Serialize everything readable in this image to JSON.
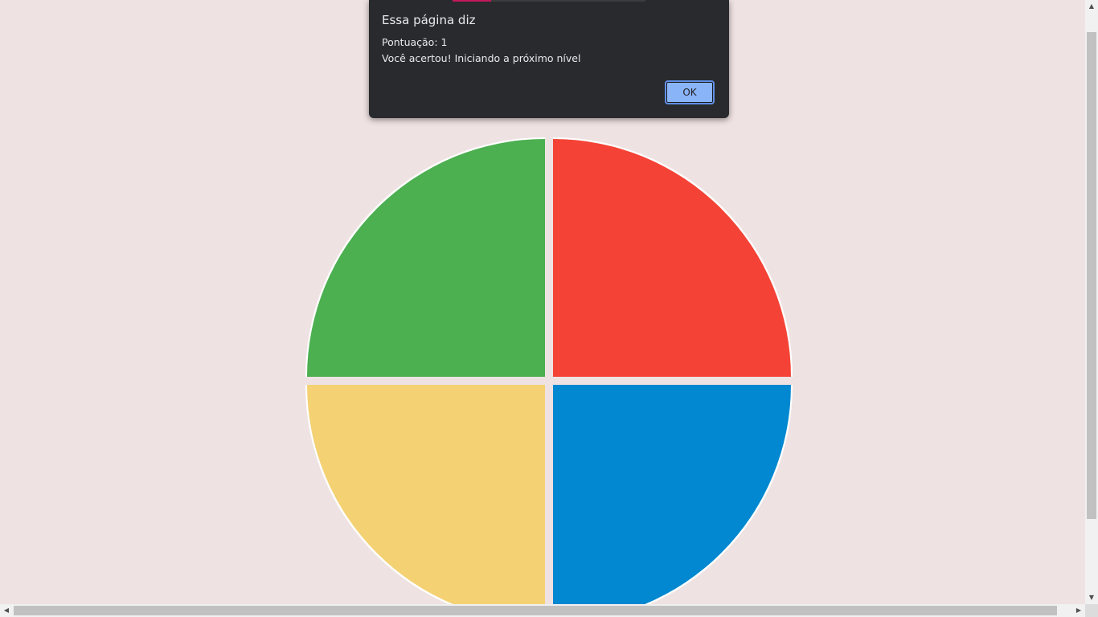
{
  "game": {
    "quadrants": [
      {
        "id": "green",
        "color": "#4caf50"
      },
      {
        "id": "red",
        "color": "#f44336"
      },
      {
        "id": "yellow",
        "color": "#f4d173"
      },
      {
        "id": "blue",
        "color": "#0288d1"
      }
    ],
    "background_color": "#efe2e2"
  },
  "dialog": {
    "title": "Essa página diz",
    "message_line1": "Pontuação: 1",
    "message_line2": "Você acertou! Iniciando a próximo nível",
    "ok_label": "OK"
  },
  "scrollbars": {
    "up_arrow": "▲",
    "down_arrow": "▼",
    "left_arrow": "◀",
    "right_arrow": "▶"
  }
}
